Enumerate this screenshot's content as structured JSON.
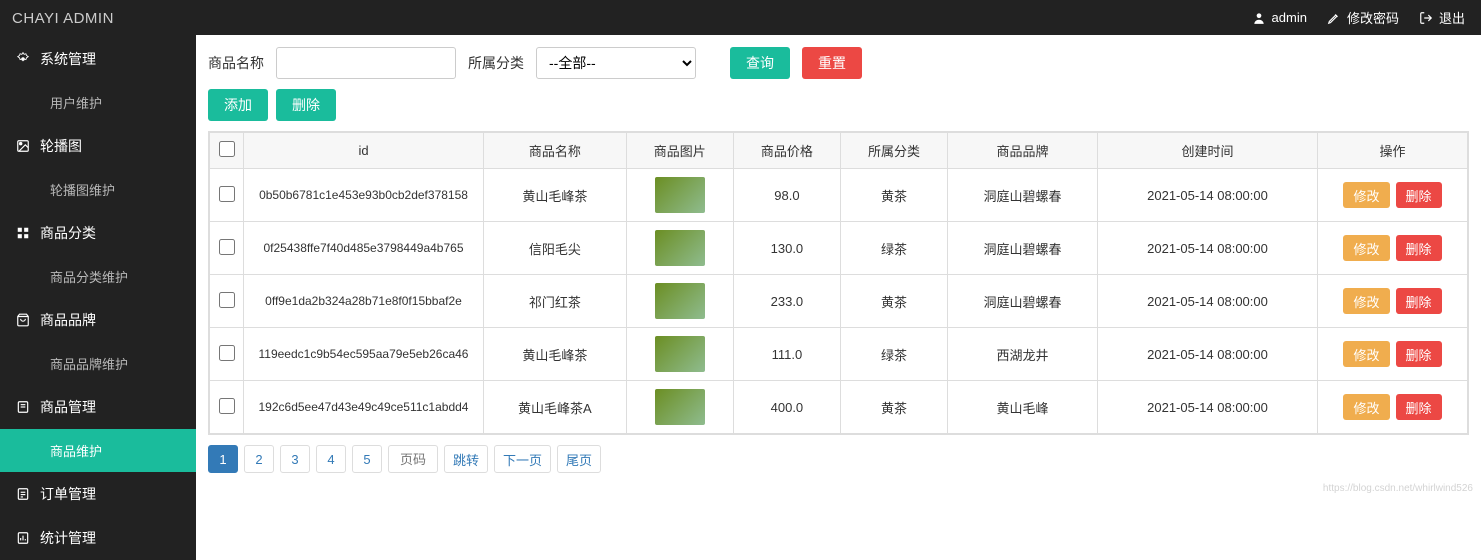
{
  "brand": "CHAYI ADMIN",
  "topbar": {
    "user": "admin",
    "change_password": "修改密码",
    "logout": "退出"
  },
  "sidebar": {
    "groups": [
      {
        "icon": "gear",
        "label": "系统管理",
        "children": [
          {
            "label": "用户维护",
            "active": false
          }
        ]
      },
      {
        "icon": "image",
        "label": "轮播图",
        "children": [
          {
            "label": "轮播图维护",
            "active": false
          }
        ]
      },
      {
        "icon": "grid",
        "label": "商品分类",
        "children": [
          {
            "label": "商品分类维护",
            "active": false
          }
        ]
      },
      {
        "icon": "bag",
        "label": "商品品牌",
        "children": [
          {
            "label": "商品品牌维护",
            "active": false
          }
        ]
      },
      {
        "icon": "doc",
        "label": "商品管理",
        "children": [
          {
            "label": "商品维护",
            "active": true
          }
        ]
      },
      {
        "icon": "list",
        "label": "订单管理",
        "children": []
      },
      {
        "icon": "chart",
        "label": "统计管理",
        "children": []
      }
    ]
  },
  "search": {
    "name_label": "商品名称",
    "name_value": "",
    "category_label": "所属分类",
    "category_value": "--全部--",
    "query_btn": "查询",
    "reset_btn": "重置"
  },
  "actions": {
    "add": "添加",
    "delete": "删除"
  },
  "table": {
    "headers": {
      "id": "id",
      "name": "商品名称",
      "image": "商品图片",
      "price": "商品价格",
      "category": "所属分类",
      "brand": "商品品牌",
      "created": "创建时间",
      "ops": "操作"
    },
    "ops_labels": {
      "edit": "修改",
      "delete": "删除"
    },
    "rows": [
      {
        "id": "0b50b6781c1e453e93b0cb2def378158",
        "name": "黄山毛峰茶",
        "price": "98.0",
        "category": "黄茶",
        "brand": "洞庭山碧螺春",
        "created": "2021-05-14 08:00:00"
      },
      {
        "id": "0f25438ffe7f40d485e3798449a4b765",
        "name": "信阳毛尖",
        "price": "130.0",
        "category": "绿茶",
        "brand": "洞庭山碧螺春",
        "created": "2021-05-14 08:00:00"
      },
      {
        "id": "0ff9e1da2b324a28b71e8f0f15bbaf2e",
        "name": "祁门红茶",
        "price": "233.0",
        "category": "黄茶",
        "brand": "洞庭山碧螺春",
        "created": "2021-05-14 08:00:00"
      },
      {
        "id": "119eedc1c9b54ec595aa79e5eb26ca46",
        "name": "黄山毛峰茶",
        "price": "111.0",
        "category": "绿茶",
        "brand": "西湖龙井",
        "created": "2021-05-14 08:00:00"
      },
      {
        "id": "192c6d5ee47d43e49c49ce511c1abdd4",
        "name": "黄山毛峰茶A",
        "price": "400.0",
        "category": "黄茶",
        "brand": "黄山毛峰",
        "created": "2021-05-14 08:00:00"
      }
    ]
  },
  "pagination": {
    "pages": [
      "1",
      "2",
      "3",
      "4",
      "5"
    ],
    "active": "1",
    "page_input_placeholder": "页码",
    "jump": "跳转",
    "next": "下一页",
    "last": "尾页"
  },
  "watermark": "https://blog.csdn.net/whirlwind526"
}
